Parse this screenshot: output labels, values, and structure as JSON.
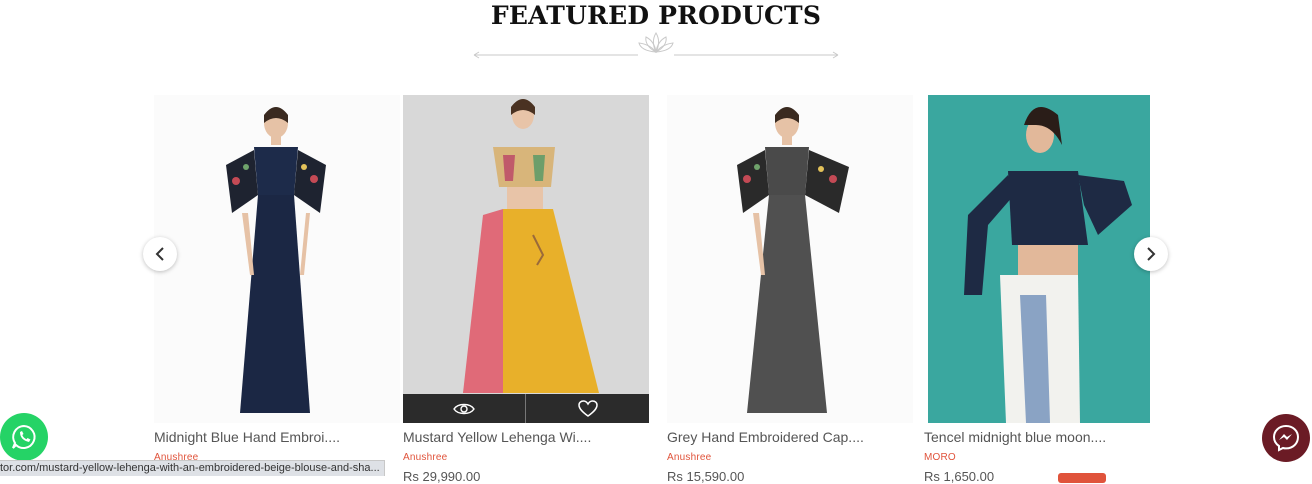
{
  "section": {
    "title": "FEATURED PRODUCTS"
  },
  "products": [
    {
      "name": "Midnight Blue Hand Embroi....",
      "brand": "Anushree",
      "price": ""
    },
    {
      "name": "Mustard Yellow Lehenga Wi....",
      "brand": "Anushree",
      "price": "Rs 29,990.00"
    },
    {
      "name": "Grey Hand Embroidered Cap....",
      "brand": "Anushree",
      "price": "Rs 15,590.00"
    },
    {
      "name": "Tencel midnight blue moon....",
      "brand": "MORO",
      "price": "Rs 1,650.00"
    }
  ],
  "overlay": {
    "quick_view_icon": "eye-icon",
    "wishlist_icon": "heart-icon"
  },
  "carousel": {
    "prev_icon": "chevron-left-icon",
    "next_icon": "chevron-right-icon"
  },
  "floating": {
    "whatsapp_icon": "whatsapp-icon",
    "messenger_icon": "messenger-icon"
  },
  "status_bar": {
    "url": "tor.com/mustard-yellow-lehenga-with-an-embroidered-beige-blouse-and-sha..."
  },
  "colors": {
    "brand_text": "#e0533b",
    "whatsapp": "#25d366",
    "messenger": "#6b1b25"
  }
}
